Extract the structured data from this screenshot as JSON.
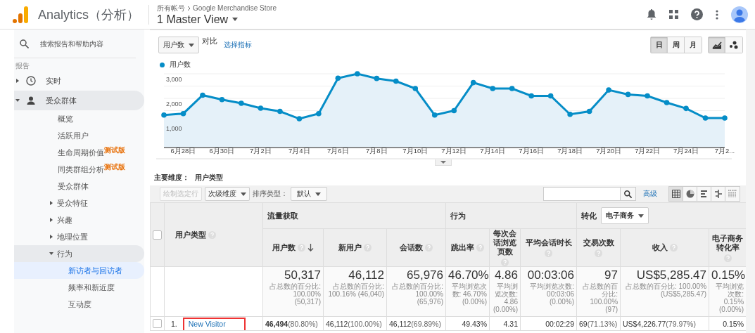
{
  "header": {
    "product": "Analytics（分析）",
    "breadcrumb": [
      "所有帐号",
      "Google Merchandise Store"
    ],
    "view": "1 Master View"
  },
  "sidebar": {
    "search": {
      "placeholder": "搜索报告和帮助内容"
    },
    "section": "报告",
    "items": [
      {
        "kind": "clock",
        "label": "实时",
        "selected": false,
        "expanded": false
      },
      {
        "kind": "person",
        "label": "受众群体",
        "selected": false,
        "expanded": true,
        "children": [
          {
            "label": "概览",
            "selected": false
          },
          {
            "label": "活跃用户",
            "selected": false
          },
          {
            "label": "生命周期价值",
            "badge": "测试版",
            "selected": false
          },
          {
            "label": "同类群组分析",
            "badge": "测试版",
            "selected": false
          },
          {
            "label": "受众群体",
            "selected": false
          },
          {
            "label": "受众特征",
            "selected": false,
            "expanded": false
          },
          {
            "label": "兴趣",
            "selected": false,
            "expanded": false
          },
          {
            "label": "地理位置",
            "selected": false,
            "expanded": false
          },
          {
            "label": "行为",
            "selected": false,
            "expanded": true,
            "children": [
              {
                "label": "新访者与回访者",
                "selected": true
              },
              {
                "label": "频率和新近度",
                "selected": false
              },
              {
                "label": "互动度",
                "selected": false
              }
            ]
          }
        ]
      }
    ]
  },
  "toolbar": {
    "metric": "用户数",
    "compare": "对比",
    "choose_metric": "选择指标",
    "granularity": [
      {
        "label": "日",
        "selected": true
      },
      {
        "label": "周",
        "selected": false
      },
      {
        "label": "月",
        "selected": false
      }
    ],
    "chart_types": [
      {
        "kind": "line",
        "selected": true
      },
      {
        "kind": "motion",
        "selected": false
      }
    ]
  },
  "chart": {
    "chart_data": {
      "type": "area",
      "categories": [
        null,
        "6月28日",
        null,
        "6月30日",
        null,
        "7月2日",
        null,
        "7月4日",
        null,
        "7月6日",
        null,
        "7月8日",
        null,
        "7月10日",
        null,
        "7月12日",
        null,
        "7月14日",
        null,
        "7月16日",
        null,
        "7月18日",
        null,
        "7月20日",
        null,
        "7月22日",
        null,
        "7月24日",
        null,
        "7月2..."
      ],
      "series": [
        {
          "name": "用户数",
          "color": "#058dc7",
          "marker": true,
          "values": [
            1320,
            1380,
            2130,
            1950,
            1800,
            1600,
            1470,
            1170,
            1380,
            2820,
            3000,
            2810,
            2700,
            2400,
            1320,
            1500,
            2640,
            2400,
            2400,
            2100,
            2100,
            1350,
            1470,
            2340,
            2160,
            2100,
            1830,
            1590,
            1200,
            1200
          ]
        }
      ],
      "ylim": [
        0,
        3000
      ],
      "yticks": [
        {
          "value": 1000,
          "label": "1,000"
        },
        {
          "value": 2000,
          "label": "2,000"
        },
        {
          "value": 3000,
          "label": "3,000"
        }
      ]
    }
  },
  "primary_dimension": {
    "label": "主要维度：",
    "value": "用户类型"
  },
  "table_toolbar": {
    "plot_rows": {
      "label": "绘制选定行",
      "disabled": true
    },
    "secondary_dimension": "次级维度",
    "sort_label": "排序类型：",
    "sort_value": "默认",
    "advanced": "高级",
    "views": [
      {
        "kind": "table",
        "selected": true
      },
      {
        "kind": "pie",
        "selected": false
      },
      {
        "kind": "bars",
        "selected": false
      },
      {
        "kind": "comparison",
        "selected": false
      },
      {
        "kind": "pivot",
        "selected": false
      }
    ]
  },
  "table": {
    "select_all": {
      "checked": false
    },
    "dimension_header": "用户类型",
    "groups": [
      {
        "label": "流量获取",
        "columns": [
          {
            "label": "用户数",
            "sorted": true
          },
          {
            "label": "新用户",
            "sorted": false
          },
          {
            "label": "会话数",
            "sorted": false
          }
        ]
      },
      {
        "label": "行为",
        "columns": [
          {
            "label": "跳出率",
            "sorted": false
          },
          {
            "label": "每次会话浏览页数",
            "sorted": false
          },
          {
            "label": "平均会话时长",
            "sorted": false
          }
        ]
      },
      {
        "label": "转化",
        "dropdown": "电子商务",
        "columns": [
          {
            "label": "交易次数",
            "sorted": false
          },
          {
            "label": "收入",
            "sorted": false
          },
          {
            "label": "电子商务转化率",
            "sorted": false
          }
        ]
      }
    ],
    "totals": [
      {
        "value": "50,317",
        "note": "占总数的百分比: 100.00% (50,317)"
      },
      {
        "value": "46,112",
        "note": "占总数的百分比: 100.16% (46,040)"
      },
      {
        "value": "65,976",
        "note": "占总数的百分比: 100.00% (65,976)"
      },
      {
        "value": "46.70%",
        "note": "平均浏览次数: 46.70% (0.00%)"
      },
      {
        "value": "4.86",
        "note": "平均浏览次数: 4.86 (0.00%)"
      },
      {
        "value": "00:03:06",
        "note": "平均浏览次数: 00:03:06 (0.00%)"
      },
      {
        "value": "97",
        "note": "占总数的百分比: 100.00% (97)"
      },
      {
        "value": "US$5,285.47",
        "note": "占总数的百分比: 100.00% (US$5,285.47)"
      },
      {
        "value": "0.15%",
        "note": "平均浏览次数: 0.15% (0.00%)"
      }
    ],
    "rows": [
      {
        "index": "1.",
        "name": "New Visitor",
        "checked": false,
        "highlighted": true,
        "cells": [
          {
            "value": "46,494",
            "share": "(80.80%)"
          },
          {
            "value": "46,112",
            "share": "(100.00%)"
          },
          {
            "value": "46,112",
            "share": "(69.89%)"
          },
          {
            "value": "49.43%"
          },
          {
            "value": "4.31"
          },
          {
            "value": "00:02:29"
          },
          {
            "value": "69",
            "share": "(71.13%)"
          },
          {
            "value": "US$4,226.77",
            "share": "(79.97%)"
          },
          {
            "value": "0.15%"
          }
        ]
      }
    ]
  }
}
